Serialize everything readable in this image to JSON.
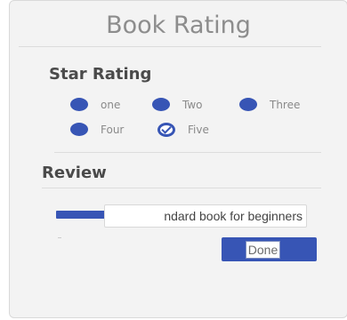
{
  "title": "Book Rating",
  "star_rating": {
    "heading": "Star Rating",
    "options": [
      {
        "label": "one",
        "checked": false
      },
      {
        "label": "Two",
        "checked": false
      },
      {
        "label": "Three",
        "checked": false
      },
      {
        "label": "Four",
        "checked": false
      },
      {
        "label": "Five",
        "checked": true
      }
    ]
  },
  "review": {
    "heading": "Review",
    "input_value": "ndard book for beginners",
    "done_label": "Done"
  },
  "colors": {
    "accent": "#3755b5",
    "title_text": "#8d8d8d",
    "card_bg": "#f3f3f3"
  }
}
